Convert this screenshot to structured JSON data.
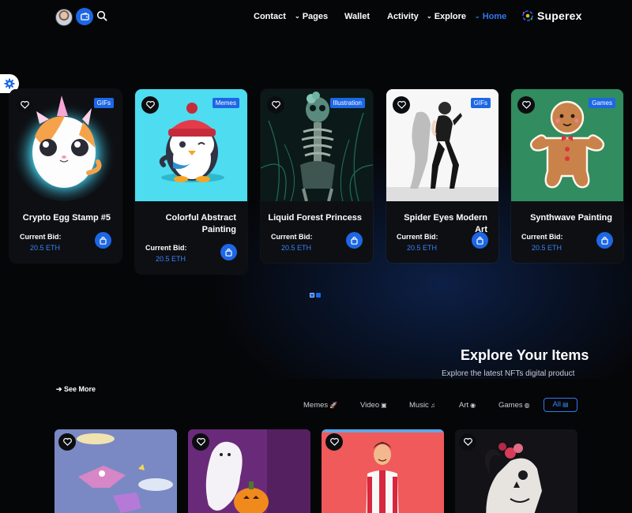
{
  "nav": {
    "items": [
      {
        "label": "Contact",
        "has_dropdown": false
      },
      {
        "label": "Pages",
        "has_dropdown": true
      },
      {
        "label": "Wallet",
        "has_dropdown": false
      },
      {
        "label": "Activity",
        "has_dropdown": false
      },
      {
        "label": "Explore",
        "has_dropdown": true
      },
      {
        "label": "Home",
        "has_dropdown": true,
        "active": true
      }
    ],
    "logo_text": "Superex",
    "chevron_glyph": "⌄"
  },
  "cards": [
    {
      "title": "Crypto Egg Stamp #5",
      "category": "GIFs",
      "bid_label": "Current Bid:",
      "bid_value": "20.5 ETH"
    },
    {
      "title": "Colorful Abstract Painting",
      "category": "Memes",
      "bid_label": "Current Bid:",
      "bid_value": "20.5 ETH"
    },
    {
      "title": "Liquid Forest Princess",
      "category": "Illustration",
      "bid_label": "Current Bid:",
      "bid_value": "20.5 ETH"
    },
    {
      "title": "Spider Eyes Modern Art",
      "category": "GIFs",
      "bid_label": "Current Bid:",
      "bid_value": "20.5 ETH"
    },
    {
      "title": "Synthwave Painting",
      "category": "Games",
      "bid_label": "Current Bid:",
      "bid_value": "20.5 ETH"
    }
  ],
  "explore": {
    "title": "Explore Your Items",
    "subtitle": "Explore the latest NFTs digital product",
    "see_more": "See More",
    "tabs": [
      {
        "label": "Memes",
        "icon": "rocket-icon"
      },
      {
        "label": "Video",
        "icon": "video-icon"
      },
      {
        "label": "Music",
        "icon": "music-icon"
      },
      {
        "label": "Art",
        "icon": "palette-icon"
      },
      {
        "label": "Games",
        "icon": "gamepad-icon"
      },
      {
        "label": "All",
        "icon": "grid-icon",
        "active": true
      }
    ]
  },
  "colors": {
    "accent": "#1d67e5",
    "background": "#050608",
    "card": "#0d0f13"
  }
}
